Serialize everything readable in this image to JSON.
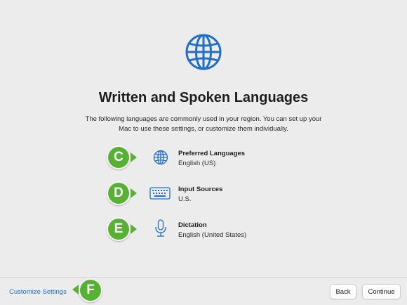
{
  "page": {
    "title": "Written and Spoken Languages",
    "description": "The following languages are commonly used in your region. You can set up your Mac to use these settings, or customize them individually."
  },
  "settings": [
    {
      "title": "Preferred Languages",
      "value": "English (US)",
      "icon": "globe-icon",
      "callout": "C"
    },
    {
      "title": "Input Sources",
      "value": "U.S.",
      "icon": "keyboard-icon",
      "callout": "D"
    },
    {
      "title": "Dictation",
      "value": "English (United States)",
      "icon": "microphone-icon",
      "callout": "E"
    }
  ],
  "footer": {
    "customize_label": "Customize Settings",
    "customize_callout": "F",
    "back_label": "Back",
    "continue_label": "Continue"
  },
  "colors": {
    "accent": "#1a6fd6",
    "callout": "#57b233",
    "background": "#ececec"
  }
}
